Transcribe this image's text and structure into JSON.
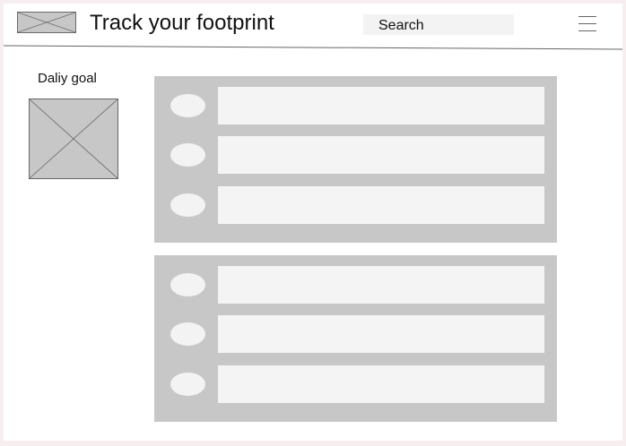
{
  "header": {
    "title": "Track your footprint",
    "search_label": "Search",
    "logo_icon": "image-placeholder-icon",
    "menu_icon": "hamburger-menu-icon"
  },
  "sidebar": {
    "goal_label": "Daliy goal",
    "goal_image_icon": "image-placeholder-icon"
  },
  "lists": [
    {
      "items": [
        "",
        "",
        ""
      ]
    },
    {
      "items": [
        "",
        "",
        ""
      ]
    }
  ],
  "colors": {
    "page_background": "#f7eef0",
    "frame_background": "#ffffff",
    "placeholder_fill": "#c7c7c7",
    "item_fill": "#f4f4f4",
    "search_fill": "#f3f3f3"
  }
}
